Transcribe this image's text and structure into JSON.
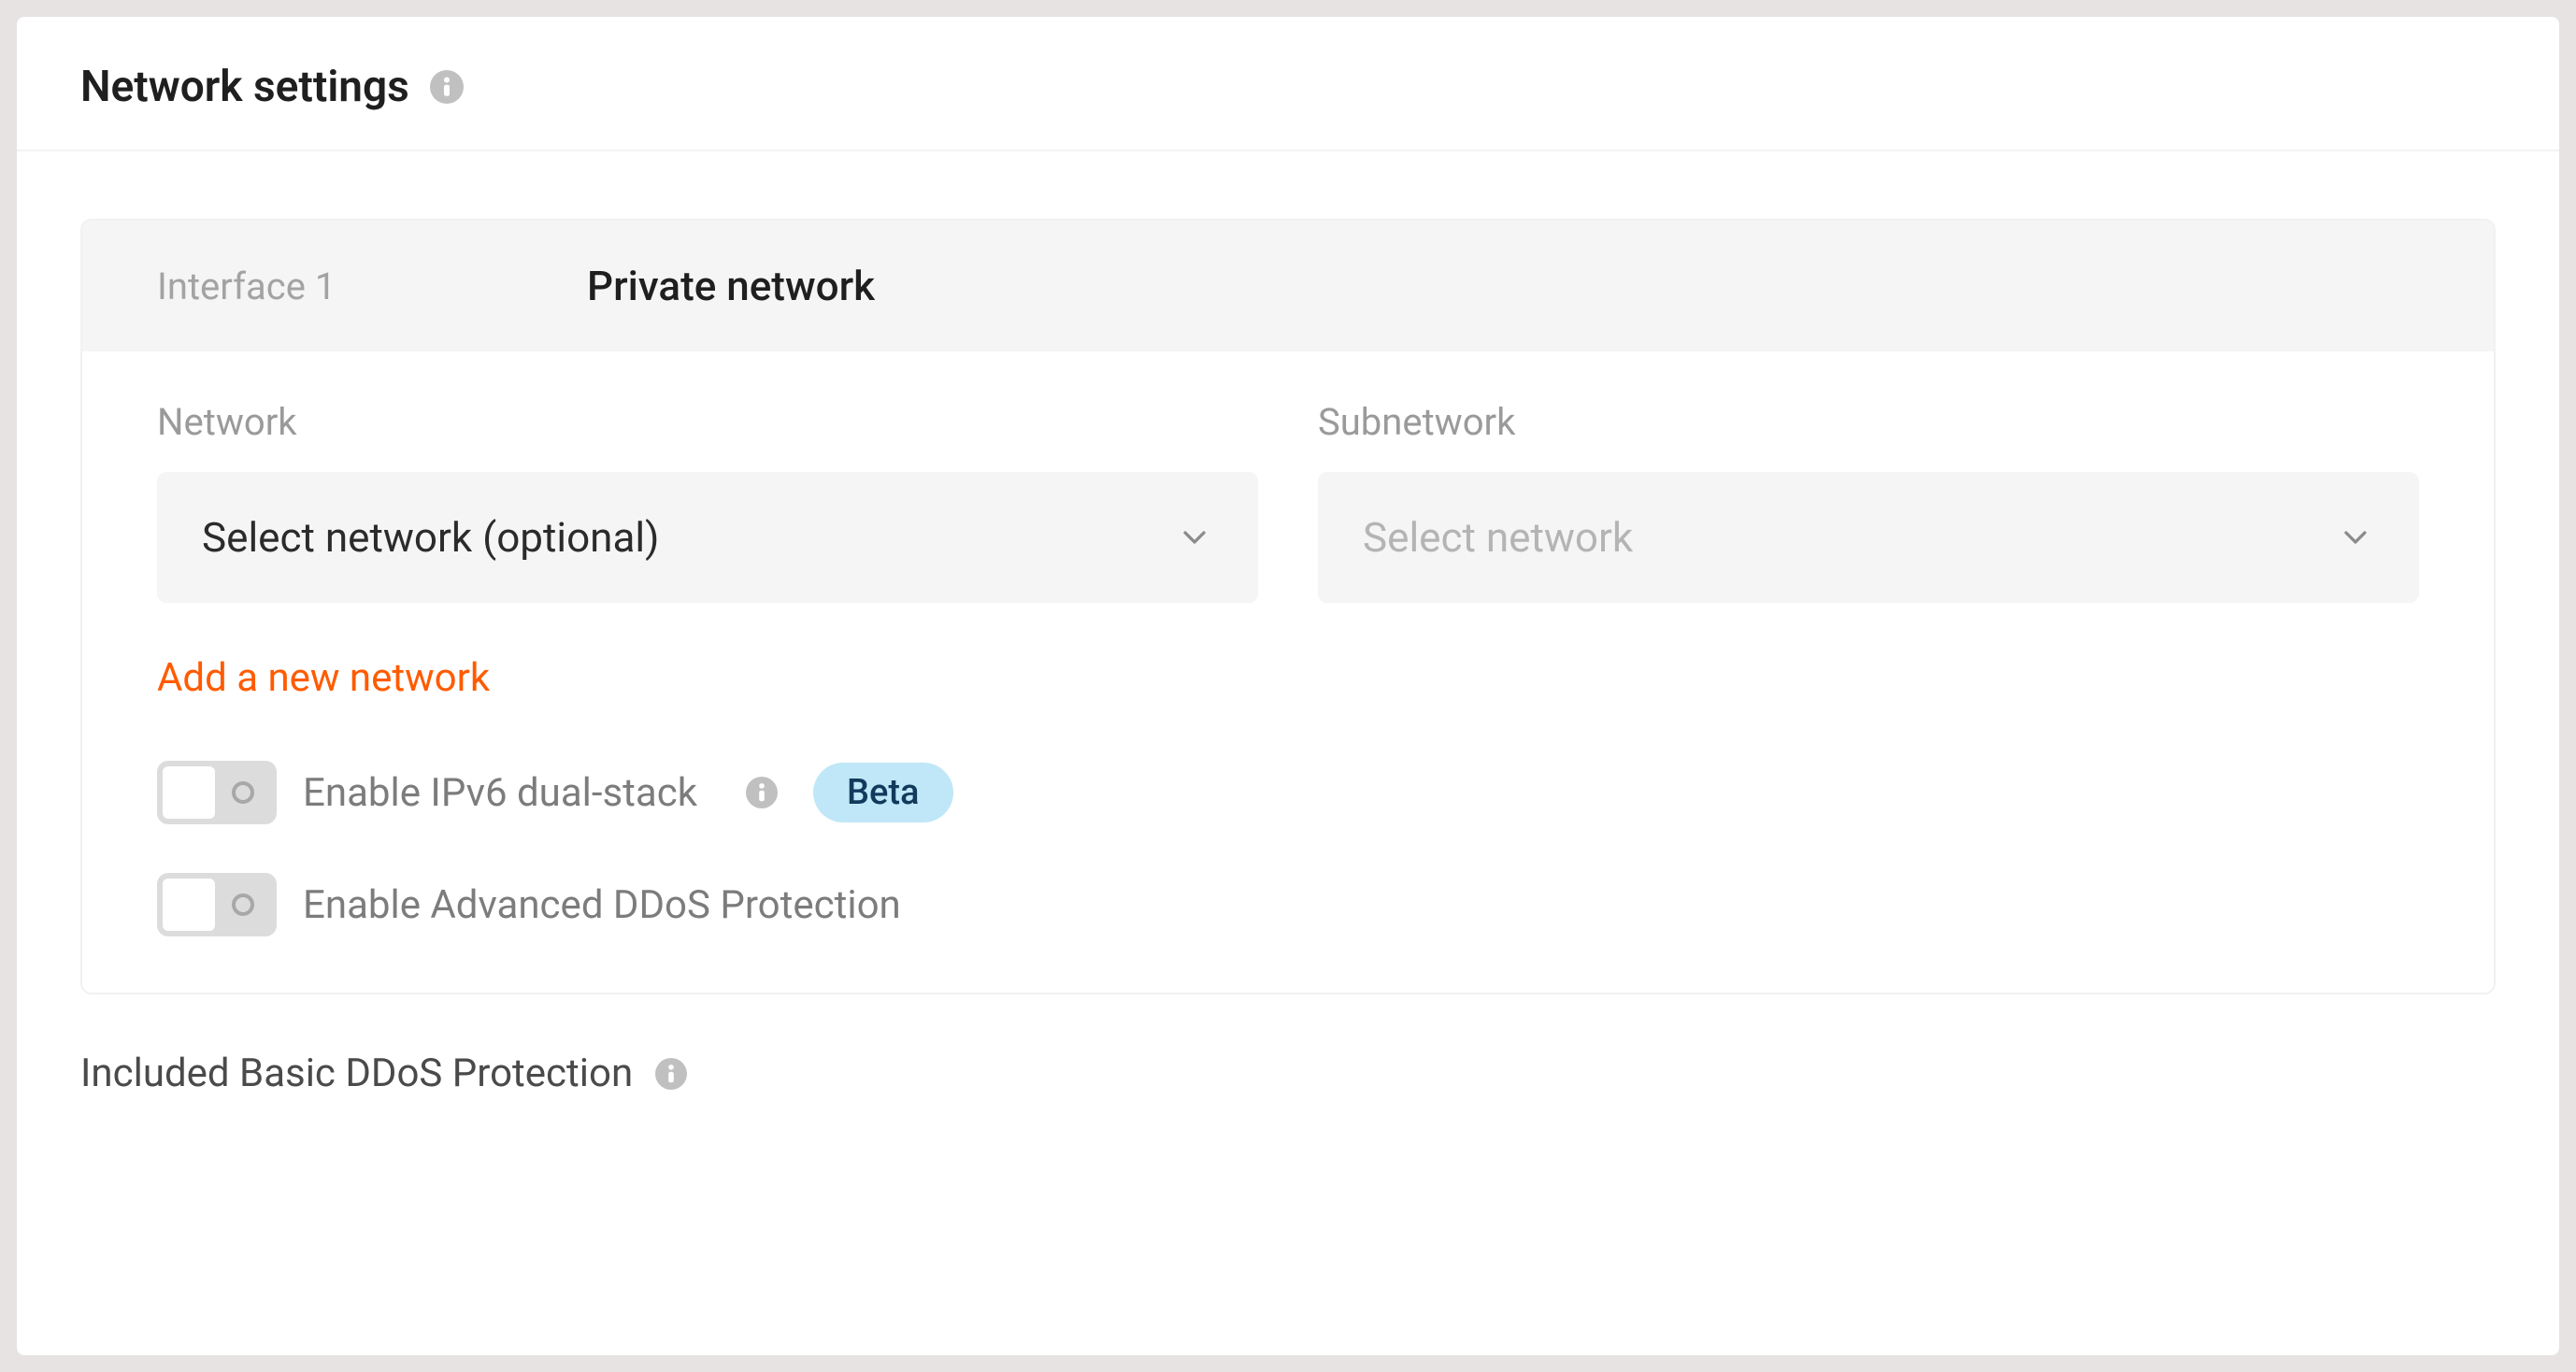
{
  "header": {
    "title": "Network settings"
  },
  "interface": {
    "label": "Interface 1",
    "name": "Private network"
  },
  "selects": {
    "network": {
      "label": "Network",
      "placeholder": "Select network (optional)"
    },
    "subnetwork": {
      "label": "Subnetwork",
      "placeholder": "Select network"
    }
  },
  "add_link": "Add a new network",
  "toggles": {
    "ipv6": {
      "label": "Enable IPv6 dual-stack",
      "badge": "Beta",
      "on": false
    },
    "ddos": {
      "label": "Enable Advanced DDoS Protection",
      "on": false
    }
  },
  "footer": {
    "text": "Included Basic DDoS Protection"
  }
}
